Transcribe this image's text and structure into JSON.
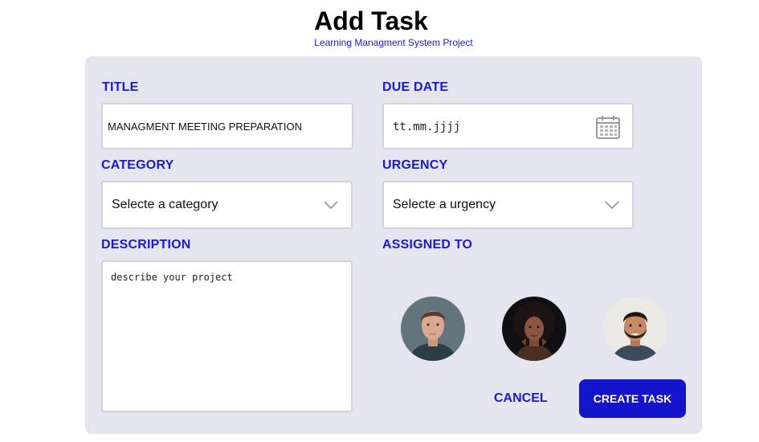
{
  "header": {
    "title": "Add Task",
    "subtitle": "Learning Managment System Project"
  },
  "form": {
    "title": {
      "label": "TITLE",
      "value": "MANAGMENT MEETING PREPARATION"
    },
    "due_date": {
      "label": "DUE DATE",
      "placeholder": "tt.mm.jjjj",
      "icon": "calendar-icon"
    },
    "category": {
      "label": "CATEGORY",
      "selected": "Selecte a category",
      "icon": "chevron-down-icon"
    },
    "urgency": {
      "label": "URGENCY",
      "selected": "Selecte a urgency",
      "icon": "chevron-down-icon"
    },
    "description": {
      "label": "DESCRIPTION",
      "placeholder": "describe your project"
    },
    "assigned_to": {
      "label": "ASSIGNED TO",
      "avatars": [
        "avatar-1",
        "avatar-2",
        "avatar-3"
      ]
    }
  },
  "actions": {
    "cancel_label": "CANCEL",
    "create_label": "CREATE TASK"
  },
  "colors": {
    "accent": "#1414cc",
    "label": "#1a1ad0",
    "card_bg": "#e5e5f0"
  }
}
